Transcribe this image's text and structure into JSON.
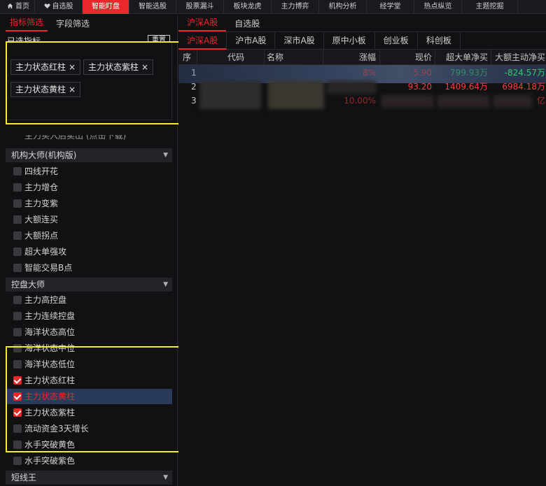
{
  "topnav": {
    "tabs": [
      {
        "label": "首页",
        "icon": "home-icon"
      },
      {
        "label": "自选股",
        "icon": "heart-icon"
      },
      {
        "label": "智能盯盘",
        "active": true
      },
      {
        "label": "智能选股"
      },
      {
        "label": "股票漏斗"
      },
      {
        "label": "板块龙虎"
      },
      {
        "label": "主力博弈"
      },
      {
        "label": "机构分析"
      },
      {
        "label": "经学堂"
      },
      {
        "label": "热点纵览"
      },
      {
        "label": "主题挖掘"
      }
    ]
  },
  "left": {
    "subtabs": [
      {
        "label": "指标筛选",
        "active": true
      },
      {
        "label": "字段筛选"
      }
    ],
    "selected_title": "已选指标",
    "reset_label": "重置",
    "chips": [
      "主力状态红柱",
      "主力状态紫柱",
      "主力状态黄柱"
    ],
    "chip_close": "×",
    "cut_text": "主力买入后卖出 (点击下载)",
    "groups": [
      {
        "label": "机构大师(机构版)",
        "items": [
          {
            "label": "四线开花",
            "checked": false
          },
          {
            "label": "主力增仓",
            "checked": false
          },
          {
            "label": "主力变紫",
            "checked": false
          },
          {
            "label": "大额连买",
            "checked": false
          },
          {
            "label": "大额拐点",
            "checked": false
          },
          {
            "label": "超大单强攻",
            "checked": false
          },
          {
            "label": "智能交易B点",
            "checked": false
          }
        ]
      },
      {
        "label": "控盘大师",
        "items": [
          {
            "label": "主力高控盘",
            "checked": false
          },
          {
            "label": "主力连续控盘",
            "checked": false
          },
          {
            "label": "海洋状态高位",
            "checked": false
          },
          {
            "label": "海洋状态中位",
            "checked": false
          },
          {
            "label": "海洋状态低位",
            "checked": false
          },
          {
            "label": "主力状态红柱",
            "checked": true
          },
          {
            "label": "主力状态黄柱",
            "checked": true,
            "selected": true
          },
          {
            "label": "主力状态紫柱",
            "checked": true
          },
          {
            "label": "流动资金3天增长",
            "checked": false
          },
          {
            "label": "水手突破黄色",
            "checked": false
          },
          {
            "label": "水手突破紫色",
            "checked": false
          }
        ]
      },
      {
        "label": "短线王",
        "items": []
      }
    ]
  },
  "right": {
    "tabs": [
      {
        "label": "沪深A股",
        "active": true
      },
      {
        "label": "自选股"
      }
    ],
    "markets": [
      {
        "label": "沪深A股",
        "active": true
      },
      {
        "label": "沪市A股"
      },
      {
        "label": "深市A股"
      },
      {
        "label": "原中小板"
      },
      {
        "label": "创业板"
      },
      {
        "label": "科创板"
      }
    ],
    "table": {
      "headers": [
        "序",
        "代码",
        "名称",
        "涨幅",
        "现价",
        "超大单净买",
        "大额主动净买"
      ],
      "rows": [
        {
          "idx": "1",
          "code": "",
          "name": "",
          "chg": "8%",
          "price": "5.90",
          "super": "799.93万",
          "big": "-824.57万"
        },
        {
          "idx": "2",
          "code": "",
          "name": "",
          "chg": "",
          "price": "93.20",
          "super": "1409.64万",
          "big": "6984.18万"
        },
        {
          "idx": "3",
          "code": "",
          "name": "",
          "chg": "10.00%",
          "price": "",
          "super": "",
          "big": "亿"
        }
      ]
    }
  },
  "colors": {
    "accent": "#e8282b",
    "highlight": "#f5ec2a",
    "selected_row": "#2a3a5c",
    "up": "#ff3b3b",
    "down": "#2ecc71"
  }
}
